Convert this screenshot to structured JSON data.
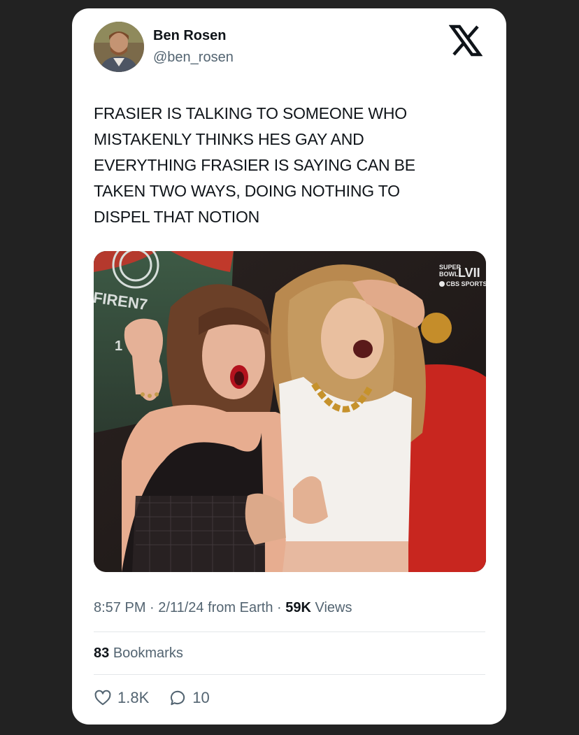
{
  "author": {
    "name": "Ben Rosen",
    "handle": "@ben_rosen"
  },
  "brand_icon": "x-logo-icon",
  "tweet": {
    "text": "FRASIER IS TALKING TO SOMEONE WHO\nMISTAKENLY THINKS HES GAY AND\nEVERYTHING FRASIER IS SAYING CAN BE\nTAKEN TWO WAYS, DOING NOTHING TO\nDISPEL THAT NOTION"
  },
  "media": {
    "broadcast_badge_line1": "SUPER",
    "broadcast_badge_line2": "BOWL",
    "broadcast_badge_numeral": "LVII",
    "broadcast_network": "CBS SPORTS",
    "banner_text": "FIREN7",
    "banner_digit": "1"
  },
  "meta": {
    "time": "8:57 PM",
    "date": "2/11/24",
    "source": "from Earth",
    "views_count": "59K",
    "views_label": "Views"
  },
  "stats": {
    "bookmarks_count": "83",
    "bookmarks_label": "Bookmarks"
  },
  "actions": {
    "likes": "1.8K",
    "replies": "10"
  },
  "colors": {
    "background": "#222222",
    "card": "#ffffff",
    "text_primary": "#0f1419",
    "text_secondary": "#536471"
  }
}
